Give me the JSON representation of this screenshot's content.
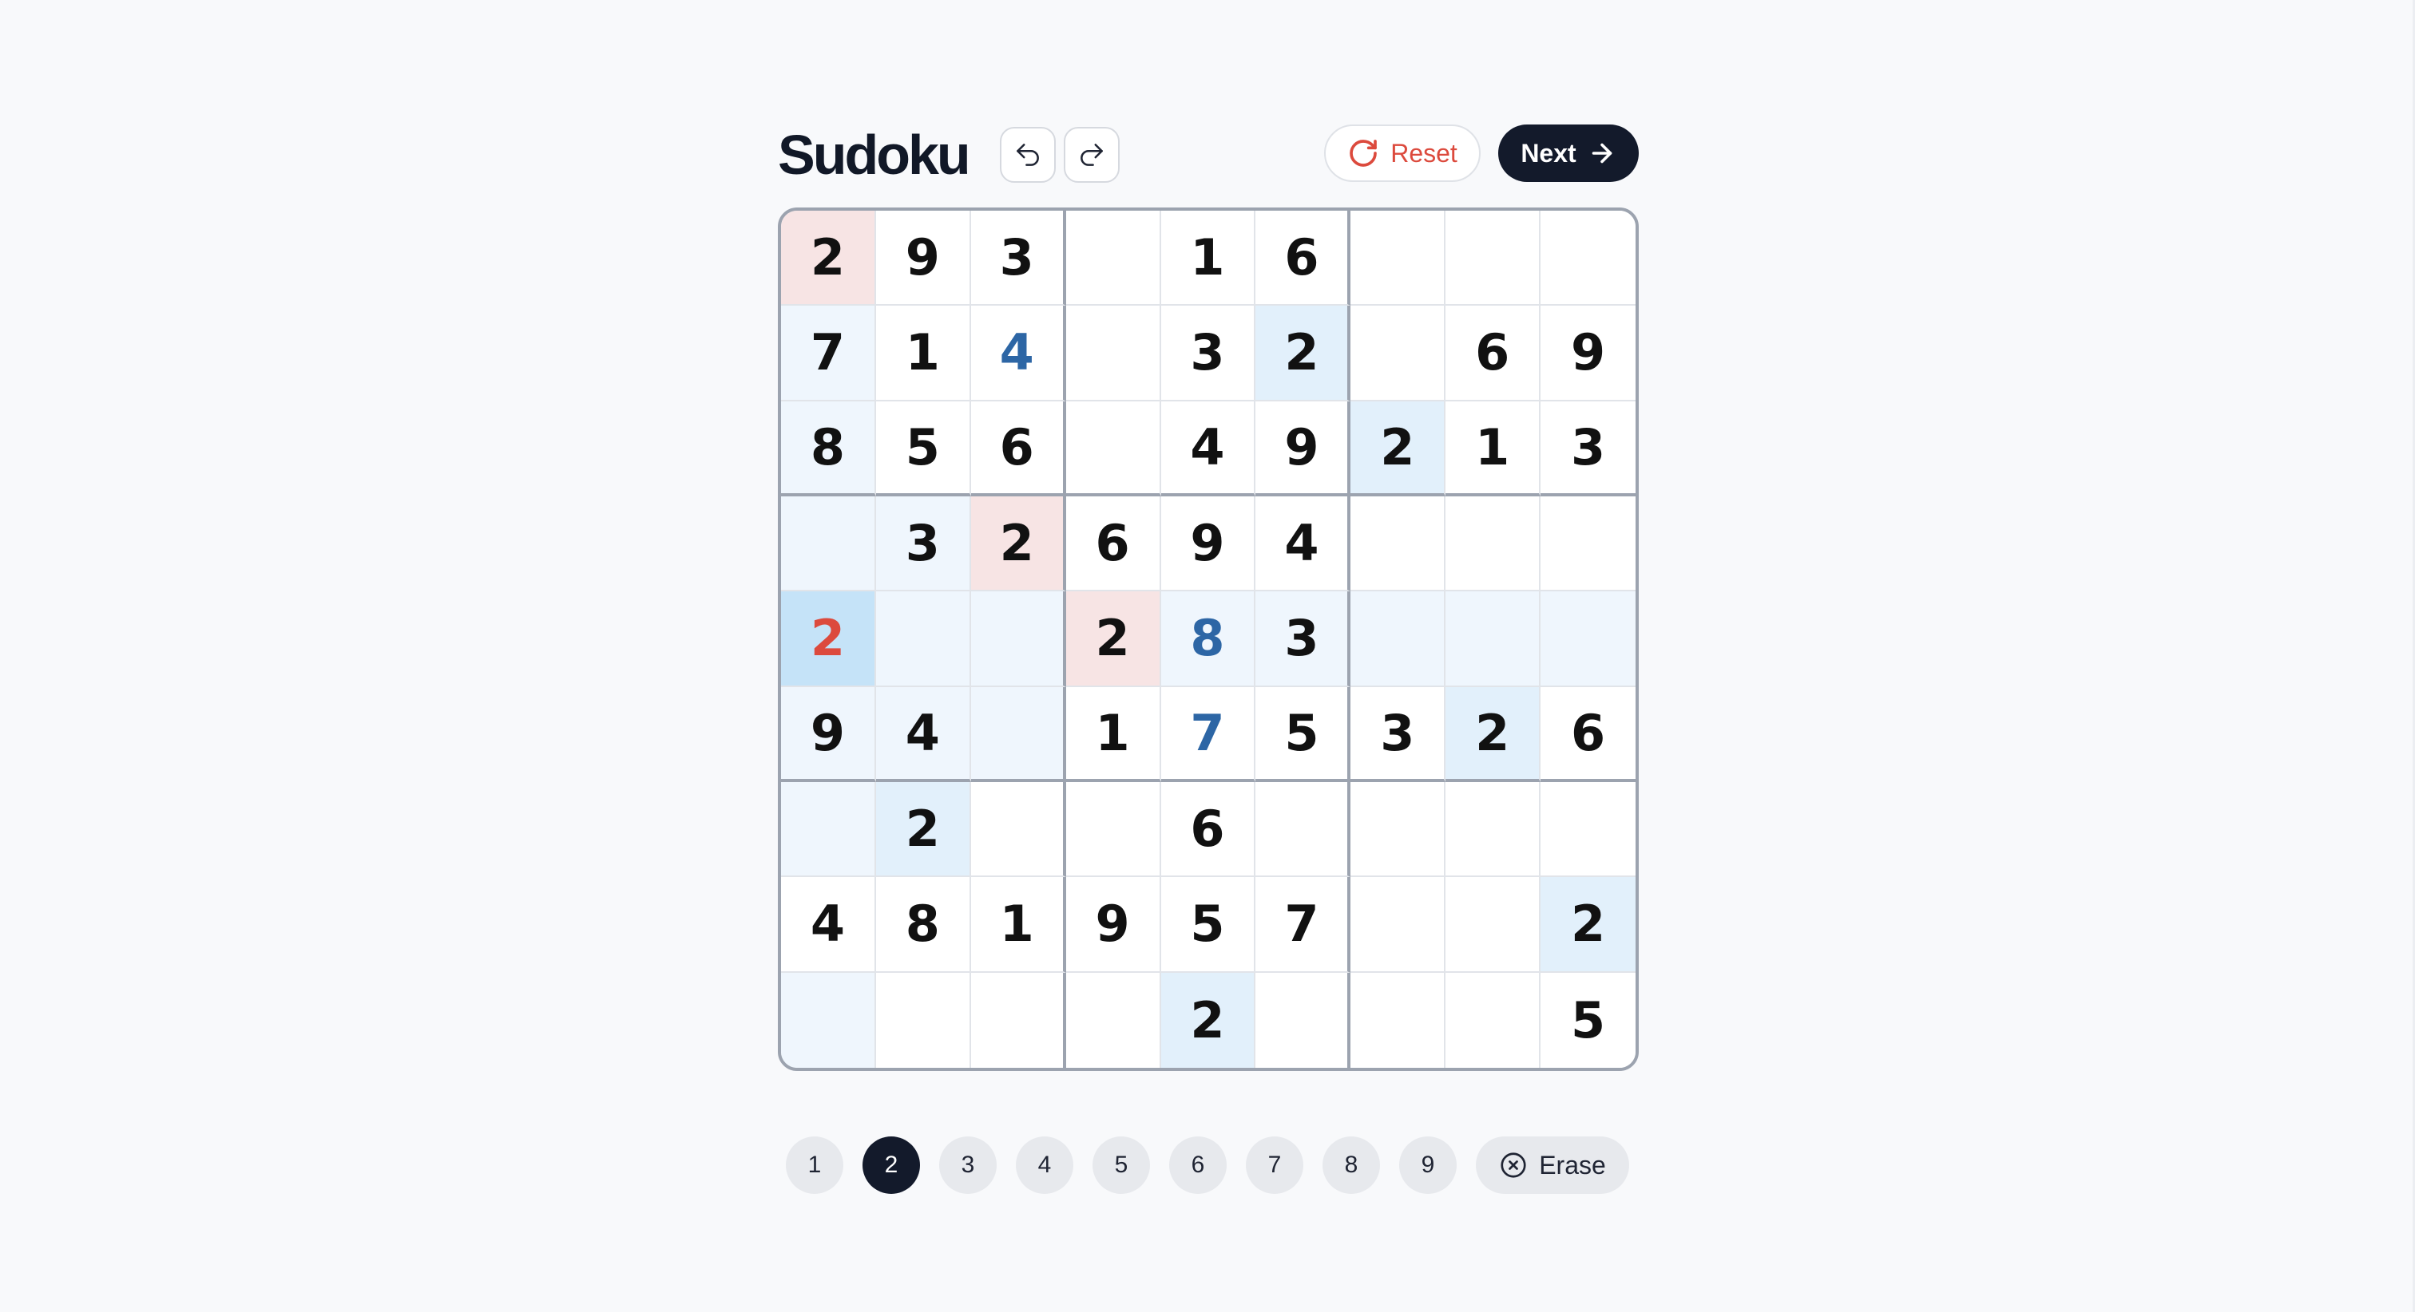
{
  "app": {
    "title": "Sudoku"
  },
  "toolbar": {
    "reset_label": "Reset",
    "next_label": "Next"
  },
  "icons": {
    "undo": "undo-icon",
    "redo": "redo-icon",
    "reset": "refresh-icon",
    "next": "arrow-right-icon",
    "erase": "x-circle-icon"
  },
  "colors": {
    "background": "#f8f9fb",
    "primary_dark": "#131a2b",
    "error_red": "#dc4a3d",
    "user_blue": "#2d66a5",
    "conflict_bg": "#f7e4e4",
    "peer_bg": "#eff6fd",
    "same_number_bg": "#e2f0fb",
    "selected_bg": "#c5e3f8",
    "grid_thick": "#9ca3af",
    "grid_thin": "#e1e4e9"
  },
  "board": {
    "size": 9,
    "selected_cell": [
      4,
      0
    ],
    "cells": [
      [
        {
          "v": "2",
          "s": "given",
          "h": "conflict"
        },
        {
          "v": "9",
          "s": "given"
        },
        {
          "v": "3",
          "s": "given"
        },
        {
          "v": ""
        },
        {
          "v": "1",
          "s": "given"
        },
        {
          "v": "6",
          "s": "given"
        },
        {
          "v": ""
        },
        {
          "v": ""
        },
        {
          "v": ""
        }
      ],
      [
        {
          "v": "7",
          "s": "given",
          "h": "peer"
        },
        {
          "v": "1",
          "s": "given"
        },
        {
          "v": "4",
          "s": "user"
        },
        {
          "v": ""
        },
        {
          "v": "3",
          "s": "given"
        },
        {
          "v": "2",
          "s": "given",
          "h": "same"
        },
        {
          "v": ""
        },
        {
          "v": "6",
          "s": "given"
        },
        {
          "v": "9",
          "s": "given"
        }
      ],
      [
        {
          "v": "8",
          "s": "given",
          "h": "peer"
        },
        {
          "v": "5",
          "s": "given"
        },
        {
          "v": "6",
          "s": "given"
        },
        {
          "v": ""
        },
        {
          "v": "4",
          "s": "given"
        },
        {
          "v": "9",
          "s": "given"
        },
        {
          "v": "2",
          "s": "given",
          "h": "same"
        },
        {
          "v": "1",
          "s": "given"
        },
        {
          "v": "3",
          "s": "given"
        }
      ],
      [
        {
          "v": "",
          "h": "peer"
        },
        {
          "v": "3",
          "s": "given",
          "h": "peer"
        },
        {
          "v": "2",
          "s": "given",
          "h": "conflict"
        },
        {
          "v": "6",
          "s": "given"
        },
        {
          "v": "9",
          "s": "given"
        },
        {
          "v": "4",
          "s": "given"
        },
        {
          "v": ""
        },
        {
          "v": ""
        },
        {
          "v": ""
        }
      ],
      [
        {
          "v": "2",
          "s": "error",
          "h": "selected"
        },
        {
          "v": "",
          "h": "peer"
        },
        {
          "v": "",
          "h": "peer"
        },
        {
          "v": "2",
          "s": "given",
          "h": "conflict"
        },
        {
          "v": "8",
          "s": "user",
          "h": "peer"
        },
        {
          "v": "3",
          "s": "given",
          "h": "peer"
        },
        {
          "v": "",
          "h": "peer"
        },
        {
          "v": "",
          "h": "peer"
        },
        {
          "v": "",
          "h": "peer"
        }
      ],
      [
        {
          "v": "9",
          "s": "given",
          "h": "peer"
        },
        {
          "v": "4",
          "s": "given",
          "h": "peer"
        },
        {
          "v": "",
          "h": "peer"
        },
        {
          "v": "1",
          "s": "given"
        },
        {
          "v": "7",
          "s": "user"
        },
        {
          "v": "5",
          "s": "given"
        },
        {
          "v": "3",
          "s": "given"
        },
        {
          "v": "2",
          "s": "given",
          "h": "same"
        },
        {
          "v": "6",
          "s": "given"
        }
      ],
      [
        {
          "v": "",
          "h": "peer"
        },
        {
          "v": "2",
          "s": "given",
          "h": "same"
        },
        {
          "v": ""
        },
        {
          "v": ""
        },
        {
          "v": "6",
          "s": "given"
        },
        {
          "v": ""
        },
        {
          "v": ""
        },
        {
          "v": ""
        },
        {
          "v": ""
        }
      ],
      [
        {
          "v": "4",
          "s": "given"
        },
        {
          "v": "8",
          "s": "given"
        },
        {
          "v": "1",
          "s": "given"
        },
        {
          "v": "9",
          "s": "given"
        },
        {
          "v": "5",
          "s": "given"
        },
        {
          "v": "7",
          "s": "given"
        },
        {
          "v": ""
        },
        {
          "v": ""
        },
        {
          "v": "2",
          "s": "given",
          "h": "same"
        }
      ],
      [
        {
          "v": "",
          "h": "peer"
        },
        {
          "v": ""
        },
        {
          "v": ""
        },
        {
          "v": ""
        },
        {
          "v": "2",
          "s": "given",
          "h": "same"
        },
        {
          "v": ""
        },
        {
          "v": ""
        },
        {
          "v": ""
        },
        {
          "v": "5",
          "s": "given"
        }
      ]
    ]
  },
  "numpad": {
    "numbers": [
      "1",
      "2",
      "3",
      "4",
      "5",
      "6",
      "7",
      "8",
      "9"
    ],
    "active": "2",
    "erase_label": "Erase"
  }
}
